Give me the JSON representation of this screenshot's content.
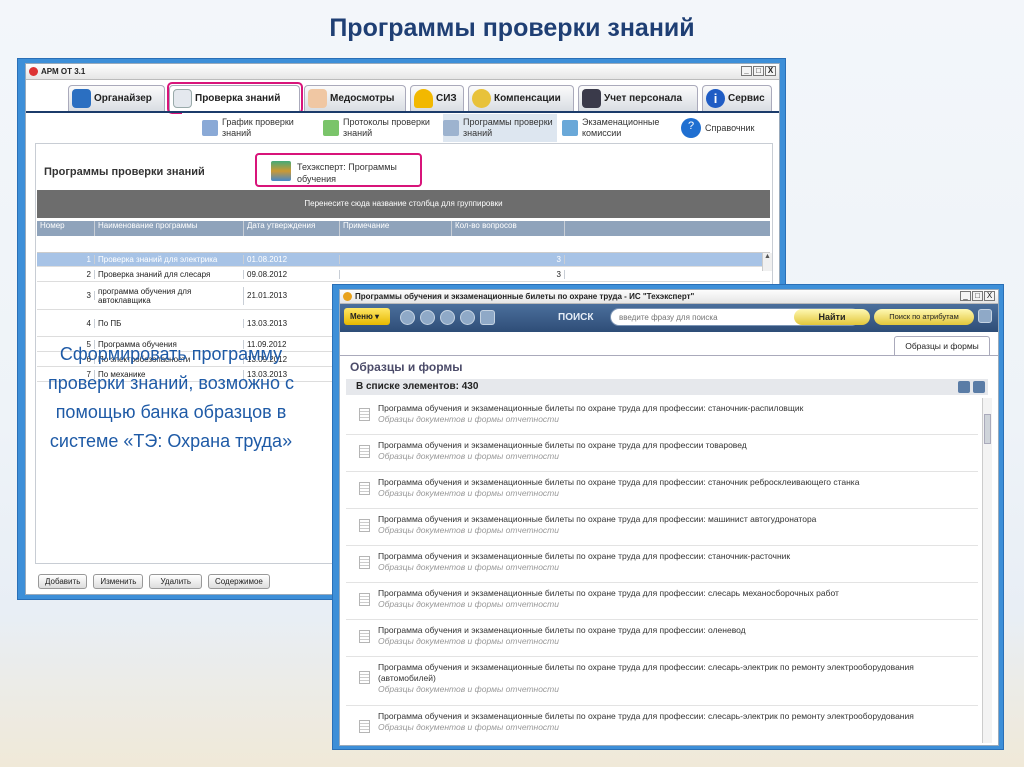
{
  "slide": {
    "title": "Программы проверки знаний"
  },
  "window1": {
    "title": "АРМ ОТ 3.1",
    "window_controls": [
      "_",
      "□",
      "X"
    ],
    "main_tabs": [
      {
        "label": "Органайзер",
        "icon": "house-icon"
      },
      {
        "label": "Проверка знаний",
        "icon": "test-check-icon",
        "active": true
      },
      {
        "label": "Медосмотры",
        "icon": "doctor-icon"
      },
      {
        "label": "СИЗ",
        "icon": "helmet-icon"
      },
      {
        "label": "Компенсации",
        "icon": "coins-icon"
      },
      {
        "label": "Учет персонала",
        "icon": "person-icon"
      },
      {
        "label": "Сервис",
        "icon": "info-icon"
      }
    ],
    "sub_tabs": [
      {
        "label": "График проверки знаний",
        "icon": "calendar-icon"
      },
      {
        "label": "Протоколы проверки знаний",
        "icon": "protocol-icon"
      },
      {
        "label": "Программы проверки знаний",
        "icon": "programs-icon",
        "active": true
      },
      {
        "label": "Экзаменационные комиссии",
        "icon": "commission-icon"
      },
      {
        "label": "Справочник",
        "icon": "help-icon"
      }
    ],
    "page_title": "Программы проверки знаний",
    "te_link": {
      "label": "Техэксперт: Программы обучения",
      "icon": "books-icon"
    },
    "group_hint": "Перенесите сюда название столбца для группировки",
    "table": {
      "columns": [
        "Номер",
        "Наименование программы",
        "Дата утверждения",
        "Примечание",
        "Кол-во вопросов"
      ],
      "rows": [
        {
          "num": "1",
          "name": "Проверка знаний для электрика",
          "date": "01.08.2012",
          "note": "",
          "count": "3",
          "selected": true
        },
        {
          "num": "2",
          "name": "Проверка знаний для слесаря",
          "date": "09.08.2012",
          "note": "",
          "count": "3"
        },
        {
          "num": "3",
          "name": "программа обучения для автоклавщика",
          "date": "21.01.2013",
          "note": "",
          "count": ""
        },
        {
          "num": "4",
          "name": "По ПБ",
          "date": "13.03.2013",
          "note": "",
          "count": ""
        },
        {
          "num": "5",
          "name": "Программа обучения",
          "date": "11.09.2012",
          "note": "",
          "count": ""
        },
        {
          "num": "6",
          "name": "По электробезопасности",
          "date": "13.09.2012",
          "note": "",
          "count": ""
        },
        {
          "num": "7",
          "name": "По механике",
          "date": "13.03.2013",
          "note": "",
          "count": ""
        }
      ]
    },
    "buttons": {
      "add": "Добавить",
      "edit": "Изменить",
      "delete": "Удалить",
      "content": "Содержимое"
    }
  },
  "caption": "Сформировать программу проверки знаний, возможно с помощью банка образцов в системе «ТЭ: Охрана труда»",
  "window2": {
    "title": "Программы обучения и экзаменационные билеты по охране труда - ИС \"Техэксперт\"",
    "window_controls": [
      "_",
      "□",
      "X"
    ],
    "menu_label": "Меню",
    "search_label": "ПОИСК",
    "search_placeholder": "введите фразу для поиска",
    "find_button": "Найти",
    "attr_search_button": "Поиск по атрибутам",
    "tab_label": "Образцы и формы",
    "section_title": "Образцы и формы",
    "count_label": "В списке элементов: 430",
    "items": [
      {
        "title": "Программа обучения и экзаменационные билеты по охране труда для профессии: станочник-распиловщик",
        "subtitle": "Образцы документов и формы отчетности"
      },
      {
        "title": "Программа обучения и экзаменационные билеты по охране труда для профессии товаровед",
        "subtitle": "Образцы документов и формы отчетности"
      },
      {
        "title": "Программа обучения и экзаменационные билеты по охране труда для профессии: станочник ребросклеивающего станка",
        "subtitle": "Образцы документов и формы отчетности"
      },
      {
        "title": "Программа обучения и экзаменационные билеты по охране труда для профессии: машинист автогудронатора",
        "subtitle": "Образцы документов и формы отчетности"
      },
      {
        "title": "Программа обучения и экзаменационные билеты по охране труда для профессии: станочник-расточник",
        "subtitle": "Образцы документов и формы отчетности"
      },
      {
        "title": "Программа обучения и экзаменационные билеты по охране труда для профессии: слесарь механосборочных работ",
        "subtitle": "Образцы документов и формы отчетности"
      },
      {
        "title": "Программа обучения и экзаменационные билеты по охране труда для профессии: оленевод",
        "subtitle": "Образцы документов и формы отчетности"
      },
      {
        "title": "Программа обучения и экзаменационные билеты по охране труда для профессии: слесарь-электрик по ремонту электрооборудования (автомобилей)",
        "subtitle": "Образцы документов и формы отчетности"
      },
      {
        "title": "Программа обучения и экзаменационные билеты по охране труда для профессии: слесарь-электрик по ремонту электрооборудования",
        "subtitle": "Образцы документов и формы отчетности"
      }
    ]
  },
  "colors": {
    "accent_blue": "#3d8fd8",
    "highlight_pink": "#d8147a",
    "caption_blue": "#1e5aa6",
    "title_navy": "#1f3f74"
  }
}
